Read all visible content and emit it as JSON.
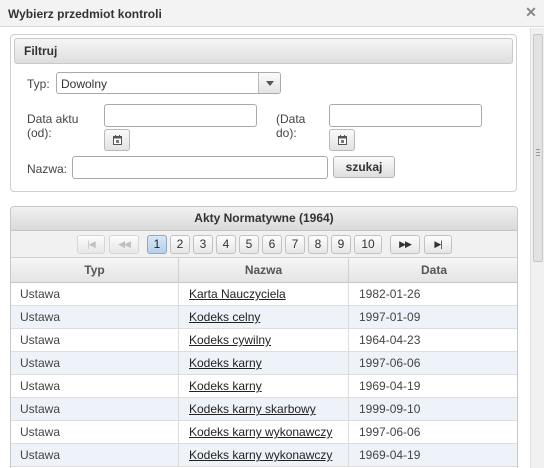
{
  "dialog": {
    "title": "Wybierz przedmiot kontroli",
    "close_icon": "close-icon"
  },
  "filter": {
    "header": "Filtruj",
    "type_label": "Typ:",
    "type_value": "Dowolny",
    "date_from_label_1": "Data aktu",
    "date_from_label_2": "(od):",
    "date_from_value": "",
    "date_to_label_1": "(Data",
    "date_to_label_2": "do):",
    "date_to_value": "",
    "name_label": "Nazwa:",
    "name_value": "",
    "search_button": "szukaj",
    "calendar_icon": "calendar-icon"
  },
  "grid": {
    "title": "Akty Normatywne (1964)",
    "pager": {
      "first": "|◀",
      "prev": "◀◀",
      "pages": [
        "1",
        "2",
        "3",
        "4",
        "5",
        "6",
        "7",
        "8",
        "9",
        "10"
      ],
      "active_page": "1",
      "next": "▶▶",
      "last": "▶|"
    },
    "columns": [
      "Typ",
      "Nazwa",
      "Data"
    ],
    "rows": [
      {
        "typ": "Ustawa",
        "nazwa": "Karta Nauczyciela",
        "data": "1982-01-26"
      },
      {
        "typ": "Ustawa",
        "nazwa": "Kodeks celny",
        "data": "1997-01-09"
      },
      {
        "typ": "Ustawa",
        "nazwa": "Kodeks cywilny",
        "data": "1964-04-23"
      },
      {
        "typ": "Ustawa",
        "nazwa": "Kodeks karny",
        "data": "1997-06-06"
      },
      {
        "typ": "Ustawa",
        "nazwa": "Kodeks karny",
        "data": "1969-04-19"
      },
      {
        "typ": "Ustawa",
        "nazwa": "Kodeks karny skarbowy",
        "data": "1999-09-10"
      },
      {
        "typ": "Ustawa",
        "nazwa": "Kodeks karny wykonawczy",
        "data": "1997-06-06"
      },
      {
        "typ": "Ustawa",
        "nazwa": "Kodeks karny wykonawczy",
        "data": "1969-04-19"
      }
    ]
  },
  "colors": {
    "row_alt": "#eef3f9",
    "active_page": "#b6d0ea"
  }
}
